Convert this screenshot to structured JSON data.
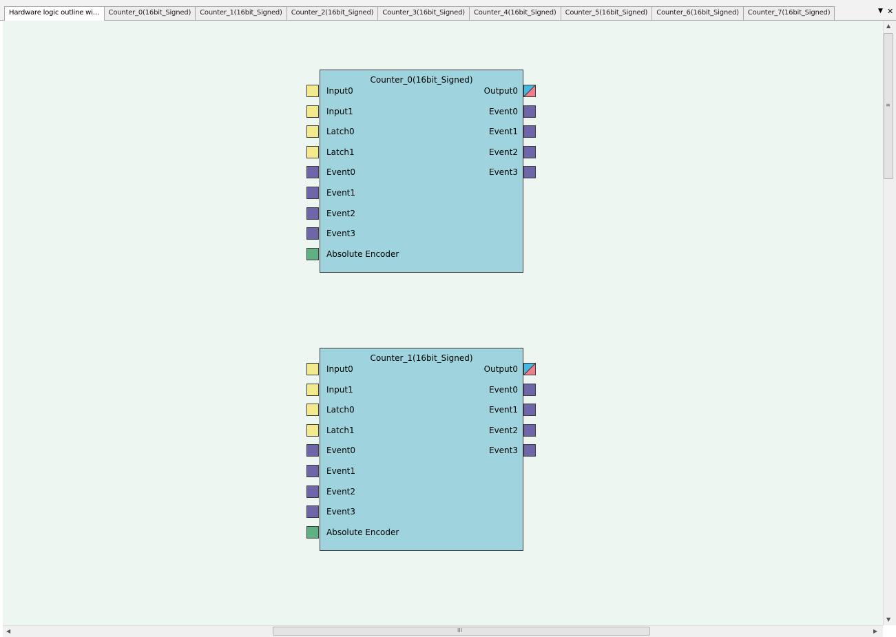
{
  "tabs": [
    {
      "label": "Hardware logic outline wi…",
      "active": true
    },
    {
      "label": "Counter_0(16bit_Signed)"
    },
    {
      "label": "Counter_1(16bit_Signed)"
    },
    {
      "label": "Counter_2(16bit_Signed)"
    },
    {
      "label": "Counter_3(16bit_Signed)"
    },
    {
      "label": "Counter_4(16bit_Signed)"
    },
    {
      "label": "Counter_5(16bit_Signed)"
    },
    {
      "label": "Counter_6(16bit_Signed)"
    },
    {
      "label": "Counter_7(16bit_Signed)"
    }
  ],
  "tab_controls": {
    "dropdown_icon": "▼",
    "close_icon": "✕"
  },
  "colors": {
    "canvas_bg": "#eef6f2",
    "block_fill": "#9fd4de",
    "port_input": "#f3ea8e",
    "port_event": "#6e66a8",
    "port_encoder": "#5fb082",
    "port_output_a": "#44b8de",
    "port_output_b": "#ee7e8c"
  },
  "blocks": [
    {
      "title": "Counter_0(16bit_Signed)",
      "left_ports": [
        {
          "label": "Input0",
          "kind": "input"
        },
        {
          "label": "Input1",
          "kind": "input"
        },
        {
          "label": "Latch0",
          "kind": "input"
        },
        {
          "label": "Latch1",
          "kind": "input"
        },
        {
          "label": "Event0",
          "kind": "event"
        },
        {
          "label": "Event1",
          "kind": "event"
        },
        {
          "label": "Event2",
          "kind": "event"
        },
        {
          "label": "Event3",
          "kind": "event"
        },
        {
          "label": "Absolute Encoder",
          "kind": "encoder"
        }
      ],
      "right_ports": [
        {
          "label": "Output0",
          "kind": "output"
        },
        {
          "label": "Event0",
          "kind": "event"
        },
        {
          "label": "Event1",
          "kind": "event"
        },
        {
          "label": "Event2",
          "kind": "event"
        },
        {
          "label": "Event3",
          "kind": "event"
        }
      ]
    },
    {
      "title": "Counter_1(16bit_Signed)",
      "left_ports": [
        {
          "label": "Input0",
          "kind": "input"
        },
        {
          "label": "Input1",
          "kind": "input"
        },
        {
          "label": "Latch0",
          "kind": "input"
        },
        {
          "label": "Latch1",
          "kind": "input"
        },
        {
          "label": "Event0",
          "kind": "event"
        },
        {
          "label": "Event1",
          "kind": "event"
        },
        {
          "label": "Event2",
          "kind": "event"
        },
        {
          "label": "Event3",
          "kind": "event"
        },
        {
          "label": "Absolute Encoder",
          "kind": "encoder"
        }
      ],
      "right_ports": [
        {
          "label": "Output0",
          "kind": "output"
        },
        {
          "label": "Event0",
          "kind": "event"
        },
        {
          "label": "Event1",
          "kind": "event"
        },
        {
          "label": "Event2",
          "kind": "event"
        },
        {
          "label": "Event3",
          "kind": "event"
        }
      ]
    }
  ],
  "scrollbars": {
    "up_arrow": "▲",
    "down_arrow": "▼",
    "left_arrow": "◀",
    "right_arrow": "▶",
    "v_grip": "≡",
    "h_grip": "III"
  }
}
